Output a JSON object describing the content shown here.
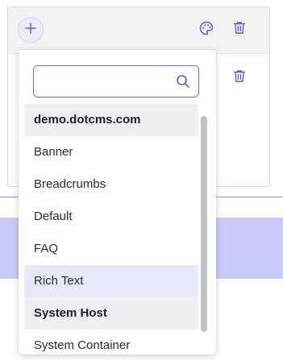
{
  "colors": {
    "accent": "#6b6ee3",
    "icon_blue": "#5b5fd6",
    "hover_row": "#e9eaf9",
    "group_row": "#efeff1",
    "band": "#c8caf8"
  },
  "card": {
    "add_icon": "plus-icon",
    "palette_icon": "palette-icon",
    "delete_icon": "trash-icon"
  },
  "dropdown": {
    "search": {
      "value": "",
      "placeholder": "",
      "icon": "search-icon"
    },
    "items": [
      {
        "label": "demo.dotcms.com",
        "kind": "group"
      },
      {
        "label": "Banner",
        "kind": "option"
      },
      {
        "label": "Breadcrumbs",
        "kind": "option"
      },
      {
        "label": "Default",
        "kind": "option"
      },
      {
        "label": "FAQ",
        "kind": "option"
      },
      {
        "label": "Rich Text",
        "kind": "option",
        "highlighted": true
      },
      {
        "label": "System Host",
        "kind": "group"
      },
      {
        "label": "System Container",
        "kind": "option"
      }
    ]
  }
}
